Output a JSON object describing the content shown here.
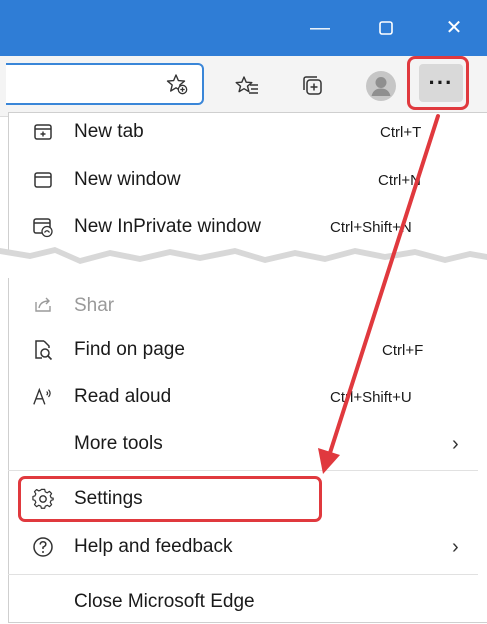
{
  "window": {
    "minimize_glyph": "—",
    "maximize_glyph": "▢",
    "close_glyph": "✕"
  },
  "toolbar": {
    "more_glyph": "···",
    "icons": [
      "add-favorite-icon",
      "favorites-icon",
      "collections-icon",
      "profile-icon"
    ]
  },
  "menu": {
    "items": [
      {
        "label": "New tab",
        "shortcut": "Ctrl+T",
        "icon": "new-tab-icon"
      },
      {
        "label": "New window",
        "shortcut": "Ctrl+N",
        "icon": "new-window-icon"
      },
      {
        "label": "New InPrivate window",
        "shortcut": "Ctrl+Shift+N",
        "icon": "inprivate-icon"
      },
      {
        "label": "Shar",
        "shortcut": "",
        "icon": "share-icon"
      },
      {
        "label": "Find on page",
        "shortcut": "Ctrl+F",
        "icon": "find-icon"
      },
      {
        "label": "Read aloud",
        "shortcut": "Ctrl+Shift+U",
        "icon": "read-aloud-icon"
      },
      {
        "label": "More tools",
        "shortcut": "",
        "icon": "",
        "chevron": "›"
      },
      {
        "label": "Settings",
        "shortcut": "",
        "icon": "gear-icon"
      },
      {
        "label": "Help and feedback",
        "shortcut": "",
        "icon": "help-icon",
        "chevron": "›"
      },
      {
        "label": "Close Microsoft Edge",
        "shortcut": "",
        "icon": ""
      }
    ]
  },
  "colors": {
    "titlebar": "#2f7dd6",
    "highlight": "#e0393e",
    "arrow": "#e0393e"
  }
}
